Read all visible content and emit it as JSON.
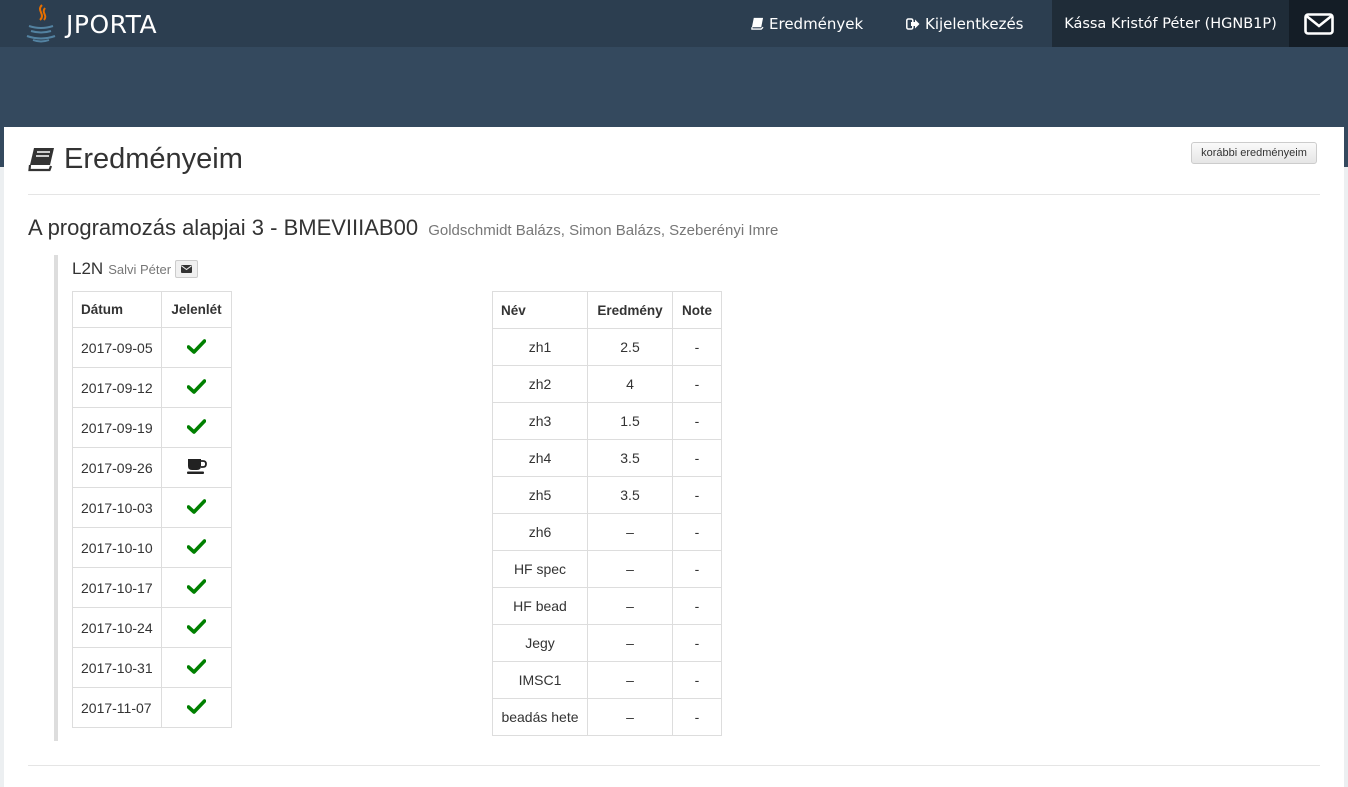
{
  "navbar": {
    "brand": "JPORTA",
    "results_label": "Eredmények",
    "logout_label": "Kijelentkezés",
    "user_label": "Kássa Kristóf Péter (HGNB1P)"
  },
  "page": {
    "title": "Eredményeim",
    "prev_results_button": "korábbi eredményeim"
  },
  "course": {
    "name": "A programozás alapjai 3 - BMEVIIIAB00",
    "lecturers": "Goldschmidt Balázs, Simon Balázs, Szeberényi Imre"
  },
  "group": {
    "code": "L2N",
    "instructor": "Salvi Péter"
  },
  "attendance": {
    "headers": [
      "Dátum",
      "Jelenlét"
    ],
    "rows": [
      {
        "date": "2017-09-05",
        "status": "check-icon"
      },
      {
        "date": "2017-09-12",
        "status": "check-icon"
      },
      {
        "date": "2017-09-19",
        "status": "check-icon"
      },
      {
        "date": "2017-09-26",
        "status": "coffee-icon"
      },
      {
        "date": "2017-10-03",
        "status": "check-icon"
      },
      {
        "date": "2017-10-10",
        "status": "check-icon"
      },
      {
        "date": "2017-10-17",
        "status": "check-icon"
      },
      {
        "date": "2017-10-24",
        "status": "check-icon"
      },
      {
        "date": "2017-10-31",
        "status": "check-icon"
      },
      {
        "date": "2017-11-07",
        "status": "check-icon"
      }
    ]
  },
  "results": {
    "headers": [
      "Név",
      "Eredmény",
      "Note"
    ],
    "rows": [
      {
        "name": "zh1",
        "result": "2.5",
        "note": "-"
      },
      {
        "name": "zh2",
        "result": "4",
        "note": "-"
      },
      {
        "name": "zh3",
        "result": "1.5",
        "note": "-"
      },
      {
        "name": "zh4",
        "result": "3.5",
        "note": "-"
      },
      {
        "name": "zh5",
        "result": "3.5",
        "note": "-"
      },
      {
        "name": "zh6",
        "result": "–",
        "note": "-"
      },
      {
        "name": "HF spec",
        "result": "–",
        "note": "-"
      },
      {
        "name": "HF bead",
        "result": "–",
        "note": "-"
      },
      {
        "name": "Jegy",
        "result": "–",
        "note": "-"
      },
      {
        "name": "IMSC1",
        "result": "–",
        "note": "-"
      },
      {
        "name": "beadás hete",
        "result": "–",
        "note": "-"
      }
    ]
  },
  "colors": {
    "navbar": "#2c3e50",
    "header_band": "#34495e",
    "check": "#008000"
  }
}
